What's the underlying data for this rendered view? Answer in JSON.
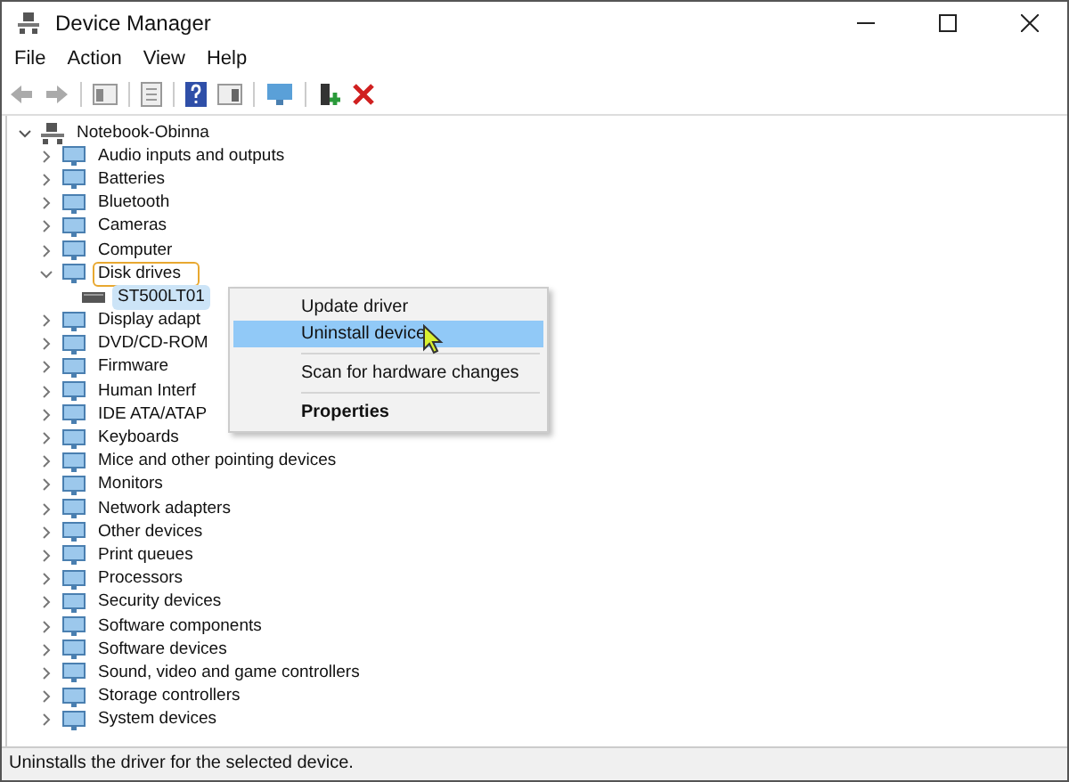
{
  "window": {
    "title": "Device Manager"
  },
  "menu_bar": [
    "File",
    "Action",
    "View",
    "Help"
  ],
  "tree": [
    {
      "label": "Notebook-Obinna",
      "expanded": true,
      "selected": false,
      "highlighted": false,
      "children": [
        {
          "label": "Audio inputs and outputs",
          "expanded": false,
          "selected": false,
          "highlighted": false
        },
        {
          "label": "Batteries",
          "expanded": false,
          "selected": false,
          "highlighted": false
        },
        {
          "label": "Bluetooth",
          "expanded": false,
          "selected": false,
          "highlighted": false
        },
        {
          "label": "Cameras",
          "expanded": false,
          "selected": false,
          "highlighted": false
        },
        {
          "label": "Computer",
          "expanded": false,
          "selected": false,
          "highlighted": false
        },
        {
          "label": "Disk drives",
          "expanded": true,
          "selected": false,
          "highlighted": true,
          "children": [
            {
              "label": "ST500LT01",
              "selected": true
            }
          ]
        },
        {
          "label": "Display adapt",
          "expanded": false,
          "selected": false,
          "highlighted": false
        },
        {
          "label": "DVD/CD-ROM",
          "expanded": false,
          "selected": false,
          "highlighted": false
        },
        {
          "label": "Firmware",
          "expanded": false,
          "selected": false,
          "highlighted": false
        },
        {
          "label": "Human Interf",
          "expanded": false,
          "selected": false,
          "highlighted": false
        },
        {
          "label": "IDE ATA/ATAP",
          "expanded": false,
          "selected": false,
          "highlighted": false
        },
        {
          "label": "Keyboards",
          "expanded": false,
          "selected": false,
          "highlighted": false
        },
        {
          "label": "Mice and other pointing devices",
          "expanded": false,
          "selected": false,
          "highlighted": false
        },
        {
          "label": "Monitors",
          "expanded": false,
          "selected": false,
          "highlighted": false
        },
        {
          "label": "Network adapters",
          "expanded": false,
          "selected": false,
          "highlighted": false
        },
        {
          "label": "Other devices",
          "expanded": false,
          "selected": false,
          "highlighted": false
        },
        {
          "label": "Print queues",
          "expanded": false,
          "selected": false,
          "highlighted": false
        },
        {
          "label": "Processors",
          "expanded": false,
          "selected": false,
          "highlighted": false
        },
        {
          "label": "Security devices",
          "expanded": false,
          "selected": false,
          "highlighted": false
        },
        {
          "label": "Software components",
          "expanded": false,
          "selected": false,
          "highlighted": false
        },
        {
          "label": "Software devices",
          "expanded": false,
          "selected": false,
          "highlighted": false
        },
        {
          "label": "Sound, video and game controllers",
          "expanded": false,
          "selected": false,
          "highlighted": false
        },
        {
          "label": "Storage controllers",
          "expanded": false,
          "selected": false,
          "highlighted": false
        },
        {
          "label": "System devices",
          "expanded": false,
          "selected": false,
          "highlighted": false
        }
      ]
    }
  ],
  "context_menu": [
    {
      "kind": "item",
      "label": "Update driver",
      "selected": false
    },
    {
      "kind": "item",
      "label": "Uninstall device",
      "selected": true
    },
    {
      "kind": "separator"
    },
    {
      "kind": "item",
      "label": "Scan for hardware changes",
      "selected": false
    },
    {
      "kind": "separator"
    },
    {
      "kind": "default",
      "label": "Properties",
      "selected": false
    }
  ],
  "status_bar": "Uninstalls the driver for the selected device."
}
